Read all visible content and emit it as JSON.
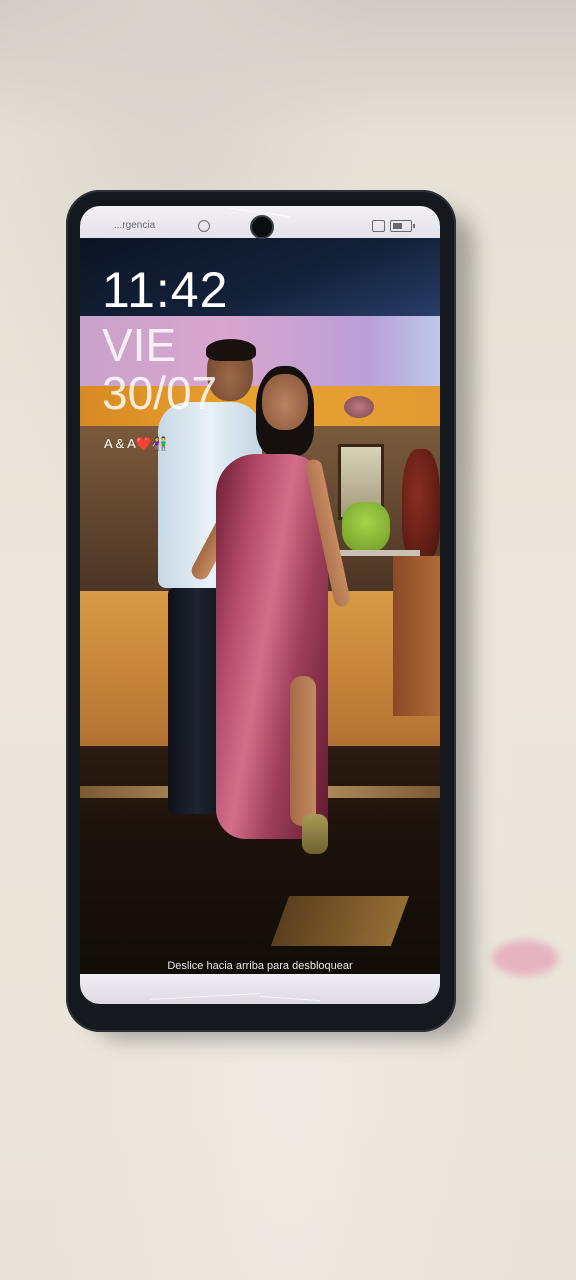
{
  "status_bar": {
    "carrier_text": "...rgencia",
    "icons": [
      "alarm-icon",
      "nfc-icon",
      "battery-icon"
    ]
  },
  "lockscreen": {
    "time": "11:42",
    "weekday": "VIE",
    "date": "30/07",
    "note": "A & A❤️👫",
    "unlock_hint": "Deslice hacia arriba para desbloquear"
  },
  "colors": {
    "desk": "#e9e4d9",
    "phone_frame": "#15181c",
    "dress": "#b34a6a",
    "lock_text": "#ffffff"
  }
}
